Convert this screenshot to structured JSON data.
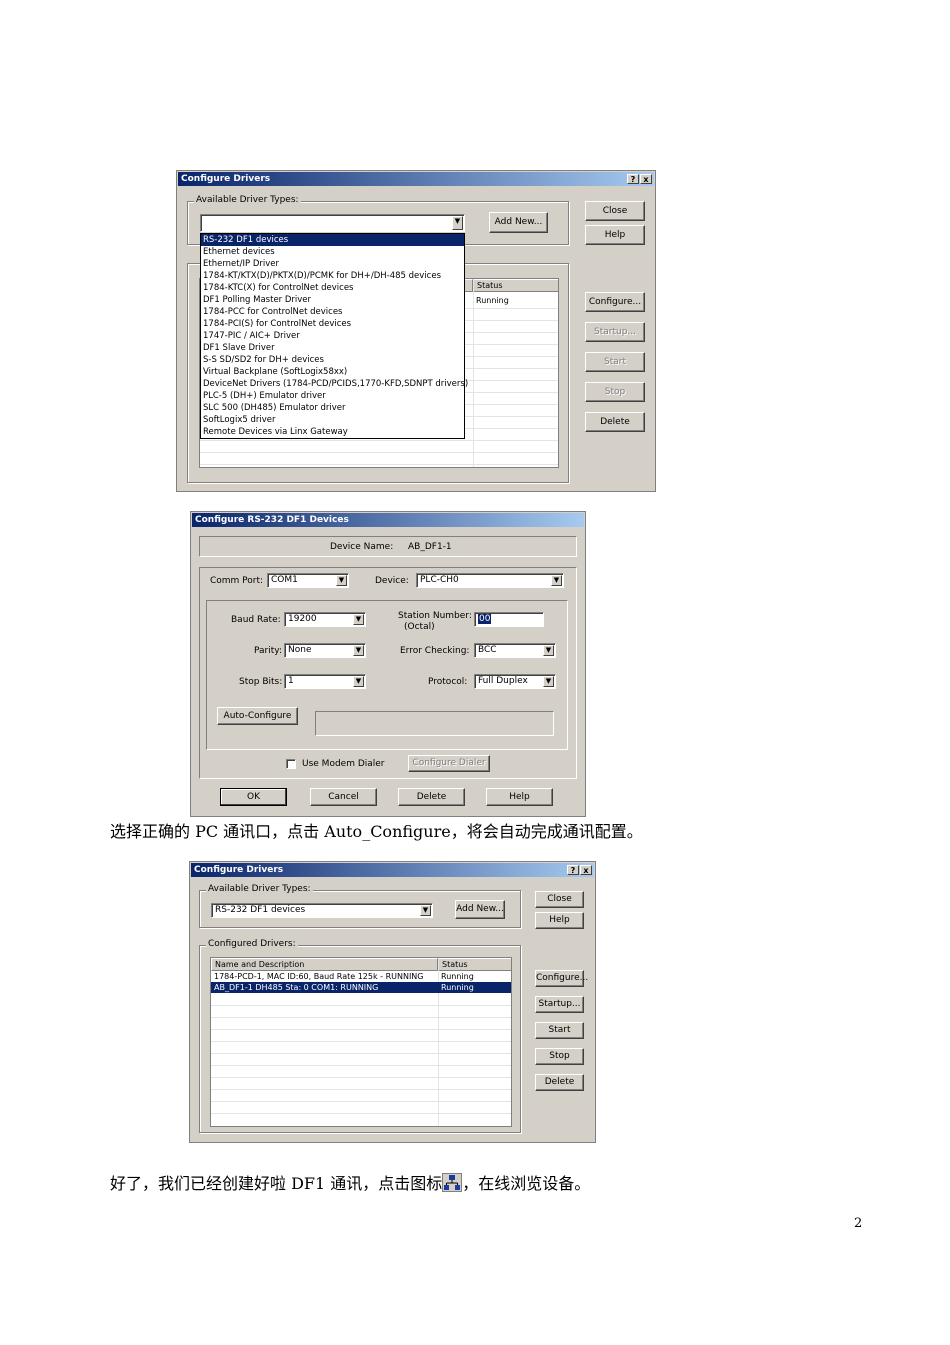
{
  "dialog1": {
    "title": "Configure Drivers",
    "help_glyph": "?",
    "close_glyph": "x",
    "available_label": "Available Driver Types:",
    "selected_driver": "",
    "add_new": "Add New...",
    "close": "Close",
    "help": "Help",
    "configure": "Configure...",
    "startup": "Startup...",
    "start": "Start",
    "stop": "Stop",
    "delete": "Delete",
    "status_header": "Status",
    "status_value": "Running",
    "driver_types": [
      "RS-232 DF1 devices",
      "Ethernet devices",
      "Ethernet/IP Driver",
      "1784-KT/KTX(D)/PKTX(D)/PCMK for DH+/DH-485 devices",
      "1784-KTC(X) for ControlNet devices",
      "DF1 Polling Master Driver",
      "1784-PCC for ControlNet devices",
      "1784-PCI(S) for ControlNet devices",
      "1747-PIC / AIC+ Driver",
      "DF1 Slave Driver",
      "S-S SD/SD2 for DH+ devices",
      "Virtual Backplane (SoftLogix58xx)",
      "DeviceNet Drivers (1784-PCD/PCIDS,1770-KFD,SDNPT drivers)",
      "PLC-5 (DH+) Emulator driver",
      "SLC 500 (DH485) Emulator driver",
      "SoftLogix5 driver",
      "Remote Devices via Linx Gateway"
    ]
  },
  "dialog2": {
    "title": "Configure RS-232 DF1 Devices",
    "device_name_label": "Device Name:",
    "device_name": "AB_DF1-1",
    "comm_port_label": "Comm Port:",
    "comm_port": "COM1",
    "device_label": "Device:",
    "device": "PLC-CH0",
    "baud_label": "Baud Rate:",
    "baud": "19200",
    "station_label": "Station Number:",
    "station_sub": "(Octal)",
    "station": "00",
    "parity_label": "Parity:",
    "parity": "None",
    "error_label": "Error Checking:",
    "error": "BCC",
    "stop_label": "Stop Bits:",
    "stop": "1",
    "protocol_label": "Protocol:",
    "protocol": "Full Duplex",
    "auto_configure": "Auto-Configure",
    "modem_label": "Use Modem Dialer",
    "configure_dialer": "Configure Dialer",
    "ok": "OK",
    "cancel": "Cancel",
    "delete": "Delete",
    "help": "Help"
  },
  "para1": "选择正确的 PC 通讯口，点击 Auto_Configure，将会自动完成通讯配置。",
  "dialog3": {
    "title": "Configure Drivers",
    "help_glyph": "?",
    "close_glyph": "x",
    "available_label": "Available Driver Types:",
    "selected_driver": "RS-232 DF1 devices",
    "add_new": "Add New...",
    "close": "Close",
    "help": "Help",
    "configured_label": "Configured Drivers:",
    "col_name": "Name and Description",
    "col_status": "Status",
    "rows": [
      {
        "name": "1784-PCD-1, MAC ID:60, Baud Rate 125k - RUNNING",
        "status": "Running"
      },
      {
        "name": "AB_DF1-1 DH485 Sta: 0 COM1: RUNNING",
        "status": "Running"
      }
    ],
    "configure": "Configure...",
    "startup": "Startup...",
    "start": "Start",
    "stop": "Stop",
    "delete": "Delete"
  },
  "para2_before": "好了，我们已经创建好啦 DF1 通讯，点击图标",
  "para2_after": "，在线浏览设备。",
  "page_number": "2"
}
